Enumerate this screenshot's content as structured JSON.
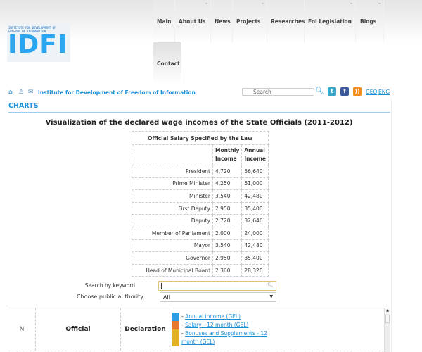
{
  "logo": {
    "small1": "INSTITUTE FOR DEVELOPMENT OF",
    "small2": "FREEDOM OF INFORMATION",
    "big": "IDFI"
  },
  "nav": [
    {
      "label": "Main"
    },
    {
      "label": "About Us"
    },
    {
      "label": "News"
    },
    {
      "label": "Projects"
    },
    {
      "label": "Researches"
    },
    {
      "label": "FoI Legislation"
    },
    {
      "label": "Blogs"
    },
    {
      "label": "Contact"
    }
  ],
  "org_link": "Institute for Development of Freedom of Information",
  "search": {
    "placeholder": "Search"
  },
  "lang": {
    "geo": "GEO",
    "eng": "ENG"
  },
  "section": "CHARTS",
  "title": "Visualization of the declared wage incomes of the State Officials (2011-2012)",
  "salary_table": {
    "caption": "Official Salary Specified by the Law",
    "col1": "Monthly Income",
    "col2": "Annual Income",
    "rows": [
      [
        "President",
        "4,720",
        "56,640"
      ],
      [
        "Prime Minister",
        "4,250",
        "51,000"
      ],
      [
        "Minister",
        "3,540",
        "42,480"
      ],
      [
        "First Deputy",
        "2,950",
        "35,400"
      ],
      [
        "Deputy",
        "2,720",
        "32,640"
      ],
      [
        "Member of Parliament",
        "2,000",
        "24,000"
      ],
      [
        "Mayor",
        "3,540",
        "42,480"
      ],
      [
        "Governor",
        "2,950",
        "35,400"
      ],
      [
        "Head of Municipal Board",
        "2,360",
        "28,320"
      ]
    ]
  },
  "filters": {
    "keyword_label": "Search by keyword",
    "keyword_value": "",
    "authority_label": "Choose public authority",
    "authority_value": "All"
  },
  "declarations": {
    "col_n": "N",
    "col_official": "Official",
    "col_declaration": "Declaration",
    "legend": [
      {
        "label": "Annual income (GEL)",
        "color": "#2a9de8"
      },
      {
        "label": "Salary - 12 month (GEL)",
        "color": "#e8772a"
      },
      {
        "label": "Bonuses and Supplements - 12 month (GEL)",
        "color": "#e0b320"
      }
    ]
  }
}
